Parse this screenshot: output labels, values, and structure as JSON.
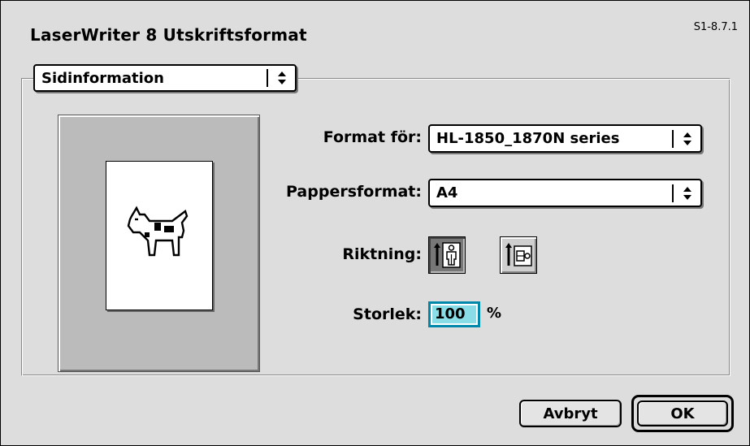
{
  "dialog": {
    "title": "LaserWriter 8 Utskriftsformat",
    "version": "S1-8.7.1",
    "section_popup": "Sidinformation"
  },
  "form": {
    "format_label": "Format för:",
    "format_value": "HL-1850_1870N series",
    "paper_label": "Pappersformat:",
    "paper_value": "A4",
    "orientation_label": "Riktning:",
    "orientation_selected": "portrait",
    "scale_label": "Storlek:",
    "scale_value": "100",
    "scale_unit": "%"
  },
  "preview": {
    "icon": "dogcow-icon"
  },
  "buttons": {
    "cancel": "Avbryt",
    "ok": "OK"
  },
  "icons": {
    "popup_arrows": "updown-arrows-icon",
    "portrait": "portrait-orientation-icon",
    "landscape": "landscape-orientation-icon"
  }
}
